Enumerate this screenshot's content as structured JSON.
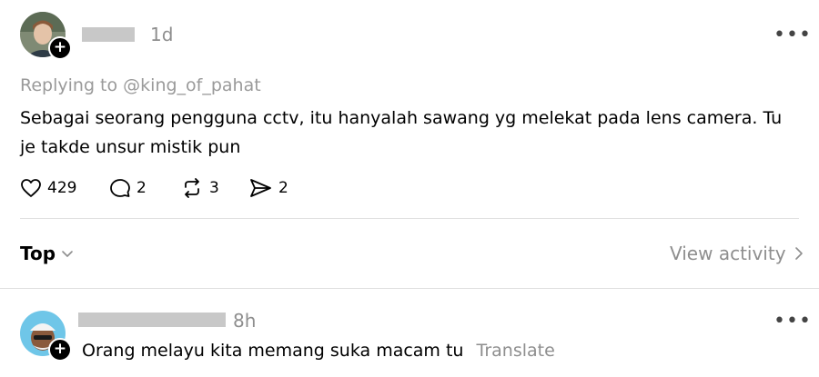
{
  "post": {
    "time": "1d",
    "more": "•••",
    "replying_to": "Replying to @king_of_pahat",
    "text": "Sebagai seorang pengguna cctv, itu hanyalah sawang yg melekat pada lens camera. Tu je takde unsur mistik pun",
    "stats": {
      "likes": "429",
      "comments": "2",
      "reposts": "3",
      "shares": "2"
    }
  },
  "sort": {
    "label": "Top",
    "view_activity": "View activity"
  },
  "reply": {
    "time": "8h",
    "more": "•••",
    "text": "Orang melayu kita memang suka macam tu",
    "translate": "Translate"
  }
}
